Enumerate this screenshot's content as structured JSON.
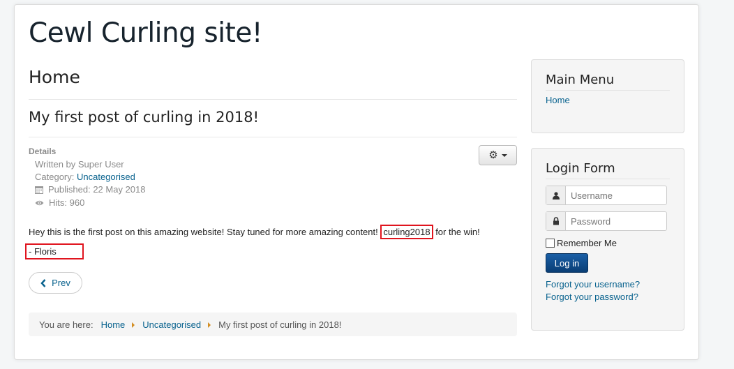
{
  "site": {
    "title": "Cewl Curling site!"
  },
  "main": {
    "page_heading": "Home",
    "post_title": "My first post of curling in 2018!",
    "details": {
      "label": "Details",
      "written_by": "Written by Super User",
      "category_label": "Category: ",
      "category_value": "Uncategorised",
      "published": "Published: 22 May 2018",
      "hits": "Hits: 960"
    },
    "body": {
      "before": "Hey this is the first post on this amazing website! Stay tuned for more amazing content! ",
      "highlight": "curling2018",
      "after": " for the win!",
      "signature": "- Floris"
    },
    "prev_label": "Prev",
    "breadcrumb": {
      "prefix": "You are here:",
      "items": [
        "Home",
        "Uncategorised",
        "My first post of curling in 2018!"
      ]
    }
  },
  "sidebar": {
    "main_menu": {
      "title": "Main Menu",
      "items": [
        "Home"
      ]
    },
    "login": {
      "title": "Login Form",
      "username_placeholder": "Username",
      "password_placeholder": "Password",
      "remember_label": "Remember Me",
      "login_label": "Log in",
      "forgot_username": "Forgot your username?",
      "forgot_password": "Forgot your password?"
    }
  },
  "colors": {
    "link": "#08628e",
    "highlight_border": "#e0141e",
    "button": "#0a4b8a"
  },
  "icons": [
    "calendar-icon",
    "eye-icon",
    "gear-icon",
    "chevron-left-icon",
    "user-icon",
    "lock-icon"
  ]
}
